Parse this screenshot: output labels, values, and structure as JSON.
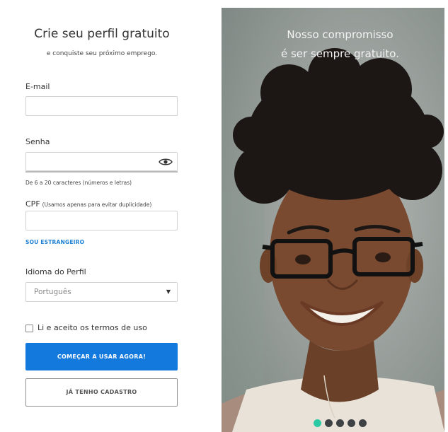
{
  "form": {
    "title": "Crie seu perfil gratuito",
    "subtitle": "e conquiste seu próximo emprego.",
    "email": {
      "label": "E-mail",
      "value": "",
      "placeholder": ""
    },
    "password": {
      "label": "Senha",
      "value": "",
      "hint": "De 6 a 20 caracteres (números e letras)",
      "toggle_icon": "eye-icon"
    },
    "cpf": {
      "label": "CPF",
      "note": "(Usamos apenas para evitar duplicidade)",
      "value": ""
    },
    "foreigner_link": "SOU ESTRANGEIRO",
    "language": {
      "label": "Idioma do Perfil",
      "selected": "Português"
    },
    "terms": {
      "label": "Li e aceito os termos de uso",
      "checked": false
    },
    "primary_button": "COMEÇAR A USAR AGORA!",
    "secondary_button": "JÁ TENHO CADASTRO"
  },
  "hero": {
    "headline_line1": "Nosso compromisso",
    "headline_line2": "é ser sempre gratuito.",
    "carousel": {
      "total": 5,
      "active": 1
    }
  },
  "colors": {
    "primary": "#1479dc",
    "link": "#1a7fd4",
    "dot_active": "#2cc9a5",
    "dot_inactive": "#3e4245"
  }
}
